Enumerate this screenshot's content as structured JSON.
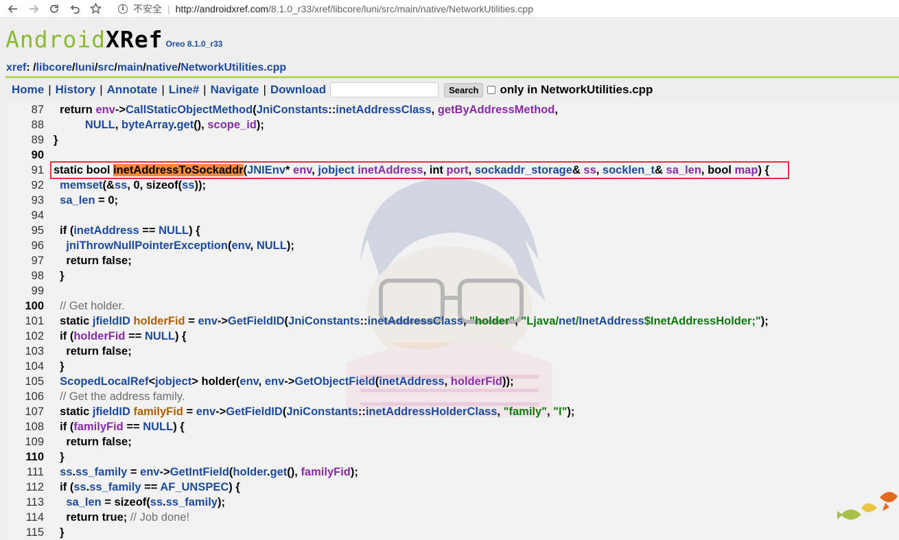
{
  "browser": {
    "security_label": "不安全",
    "url_host": "http://androidxref.com",
    "url_path": "/8.1.0_r33/xref/libcore/luni/src/main/native/NetworkUtilities.cpp"
  },
  "header": {
    "logo_android": "Android",
    "logo_xref": "XRef",
    "version": "Oreo 8.1.0_r33"
  },
  "breadcrumb": {
    "root": "xref",
    "path": [
      "libcore",
      "luni",
      "src",
      "main",
      "native",
      "NetworkUtilities.cpp"
    ]
  },
  "toolbar": {
    "home": "Home",
    "history": "History",
    "annotate": "Annotate",
    "line": "Line#",
    "navigate": "Navigate",
    "download": "Download",
    "search_value": "",
    "search_button": "Search",
    "only_in": "only in NetworkUtilities.cpp"
  },
  "code": {
    "line_numbers": [
      "87",
      "88",
      "89",
      "90",
      "91",
      "92",
      "93",
      "94",
      "95",
      "96",
      "97",
      "98",
      "99",
      "100",
      "101",
      "102",
      "103",
      "104",
      "105",
      "106",
      "107",
      "108",
      "109",
      "110",
      "111",
      "112",
      "113",
      "114",
      "115"
    ],
    "highlighted_function": "inetAddressToSockaddr"
  }
}
